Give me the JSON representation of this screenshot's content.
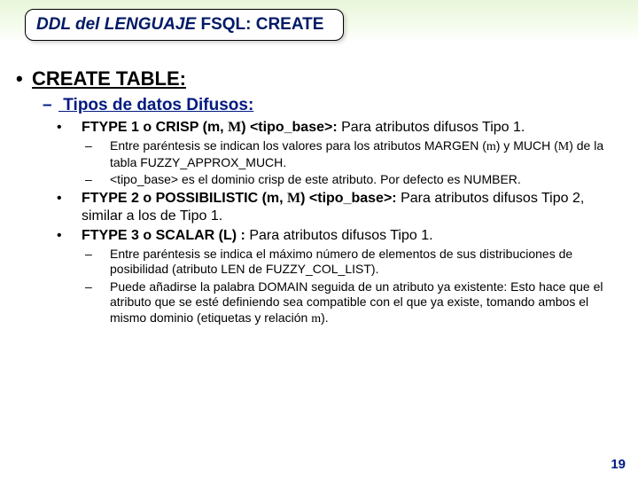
{
  "title": {
    "italic": "DDL del  LENGUAJE",
    "plain": "  FSQL: CREATE"
  },
  "l1": "CREATE TABLE:",
  "l2": " Tipos de datos Difusos:",
  "items": {
    "f1": {
      "lead": "FTYPE 1 o CRISP (m, ",
      "M": "M",
      "mid": ") <tipo_base>:",
      "rest": " Para atributos difusos Tipo 1."
    },
    "f1sub": {
      "a_pre": "Entre paréntesis se indican los valores para los atributos MARGEN (",
      "a_m": "m",
      "a_mid": ") y MUCH (",
      "a_M": "M",
      "a_post": ") de la tabla FUZZY_APPROX_MUCH.",
      "b": "<tipo_base> es el dominio crisp de este atributo. Por defecto es NUMBER."
    },
    "f2": {
      "lead": "FTYPE 2 o POSSIBILISTIC (m, ",
      "M": "M",
      "mid": ") <tipo_base>:",
      "rest": " Para atributos difusos Tipo 2, similar a los de Tipo 1."
    },
    "f3": {
      "lead": "FTYPE 3 o SCALAR (L) :",
      "rest": " Para atributos difusos Tipo 1."
    },
    "f3sub": {
      "a": "Entre paréntesis se indica el máximo número de elementos de sus distribuciones de posibilidad (atributo LEN de FUZZY_COL_LIST).",
      "b_pre": "Puede añadirse la palabra DOMAIN seguida de un atributo ya existente: Esto hace que el atributo que se esté definiendo sea compatible con el que ya existe, tomando ambos el mismo dominio (etiquetas y relación ",
      "b_mu": "m",
      "b_post": ")."
    }
  },
  "pagenum": "19"
}
